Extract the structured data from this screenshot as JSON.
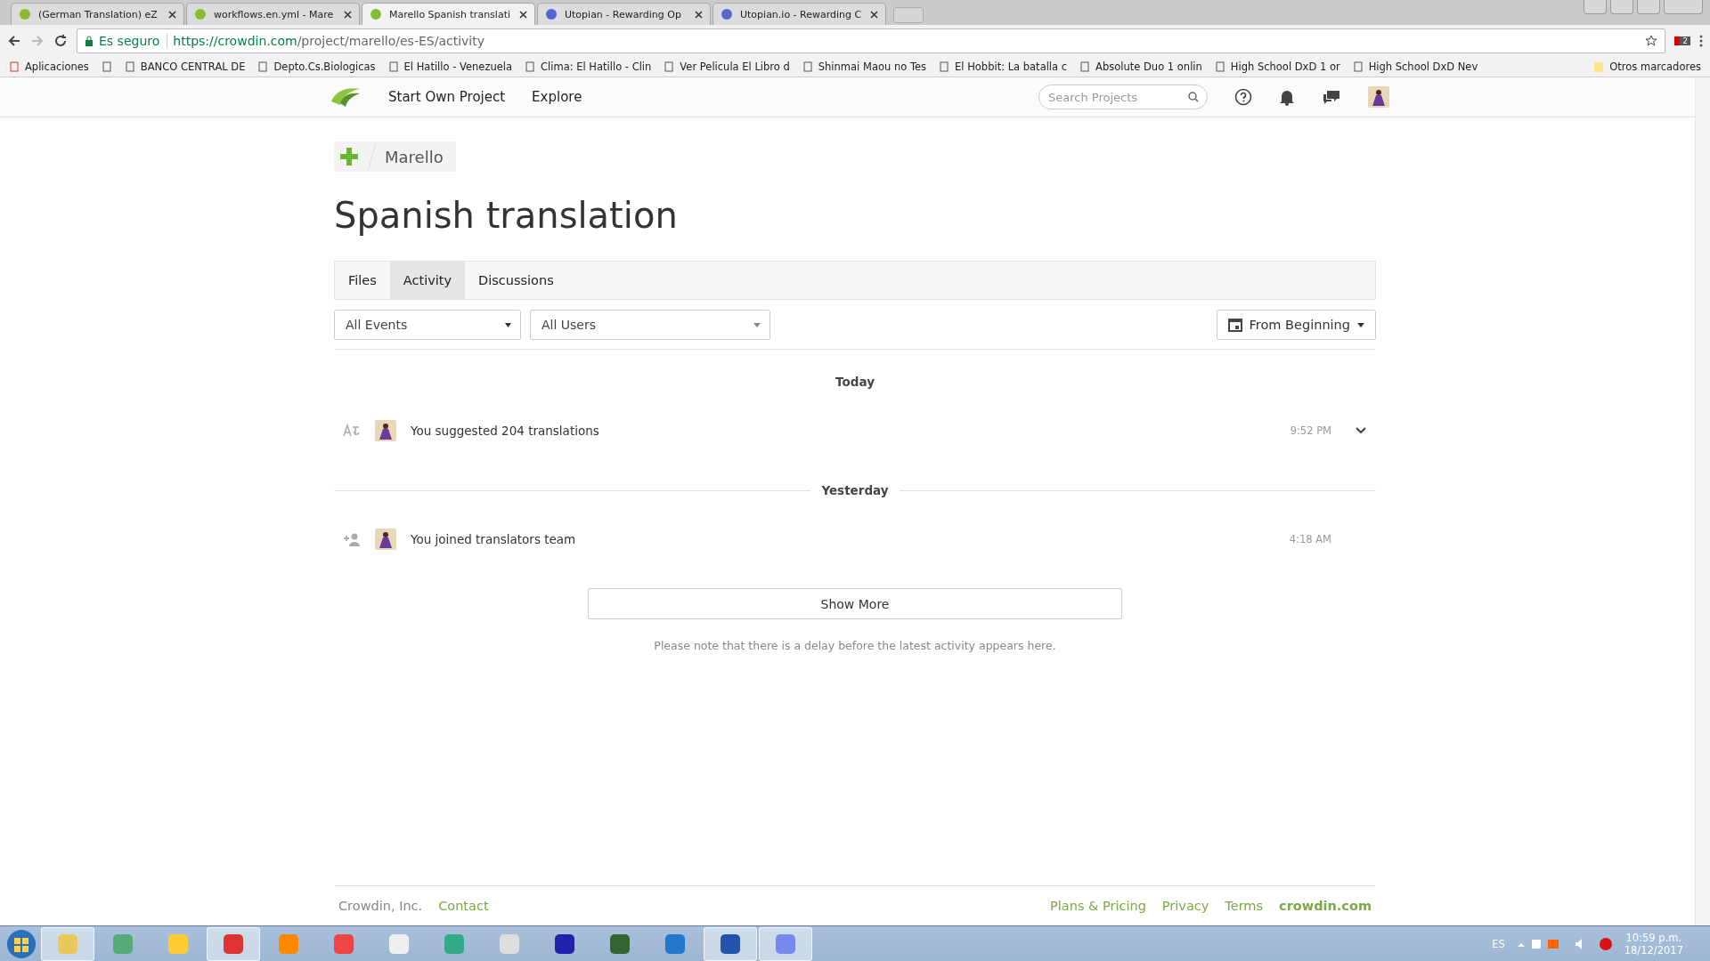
{
  "browser": {
    "tabs": [
      {
        "title": "(German Translation) eZ",
        "selected": false
      },
      {
        "title": "workflows.en.yml - Mare",
        "selected": false
      },
      {
        "title": "Marello Spanish translati",
        "selected": true
      },
      {
        "title": "Utopian - Rewarding Op",
        "selected": false
      },
      {
        "title": "Utopian.io - Rewarding C",
        "selected": false
      }
    ],
    "secure_label": "Es seguro",
    "url_host": "https://crowdin.com",
    "url_path": "/project/marello/es-ES/activity",
    "extension_badge": "2",
    "bookmarks": [
      "Aplicaciones",
      "BANCO CENTRAL DE",
      "Depto.Cs.Biologicas",
      "El Hatillo - Venezuela",
      "Clima: El Hatillo - Clin",
      "Ver Pelicula El Libro d",
      "Shinmai Maou no Tes",
      "El Hobbit: La batalla c",
      "Absolute Duo 1 onlin",
      "High School DxD 1 or",
      "High School DxD Nev"
    ],
    "other_bookmarks": "Otros marcadores"
  },
  "header": {
    "nav": [
      "Start Own Project",
      "Explore"
    ],
    "search": {
      "placeholder": "Search Projects"
    }
  },
  "breadcrumb": "Marello",
  "title": "Spanish translation",
  "tabs": [
    {
      "label": "Files",
      "selected": false
    },
    {
      "label": "Activity",
      "selected": true
    },
    {
      "label": "Discussions",
      "selected": false
    }
  ],
  "filters": {
    "events": "All Events",
    "users": "All Users",
    "period": "From Beginning"
  },
  "groups": [
    {
      "day": "Today",
      "divider": false,
      "items": [
        {
          "kind": "translate",
          "text": "You suggested 204 translations",
          "time": "9:52 PM",
          "expandable": true
        }
      ]
    },
    {
      "day": "Yesterday",
      "divider": true,
      "items": [
        {
          "kind": "join",
          "text": "You joined translators team",
          "time": "4:18 AM",
          "expandable": false
        }
      ]
    }
  ],
  "show_more": "Show More",
  "note": "Please note that there is a delay before the latest activity appears here.",
  "footer": {
    "left": [
      "Crowdin, Inc.",
      "Contact"
    ],
    "right": [
      "Plans & Pricing",
      "Privacy",
      "Terms",
      "crowdin.com"
    ]
  },
  "taskbar": {
    "apps": [
      {
        "running": true
      },
      {
        "running": false
      },
      {
        "running": false
      },
      {
        "running": true
      },
      {
        "running": false
      },
      {
        "running": false
      },
      {
        "running": false
      },
      {
        "running": false
      },
      {
        "running": false
      },
      {
        "running": false
      },
      {
        "running": false
      },
      {
        "running": false
      },
      {
        "running": true
      },
      {
        "running": true
      }
    ],
    "language": "ES",
    "time": "10:59 p.m.",
    "date": "18/12/2017"
  }
}
